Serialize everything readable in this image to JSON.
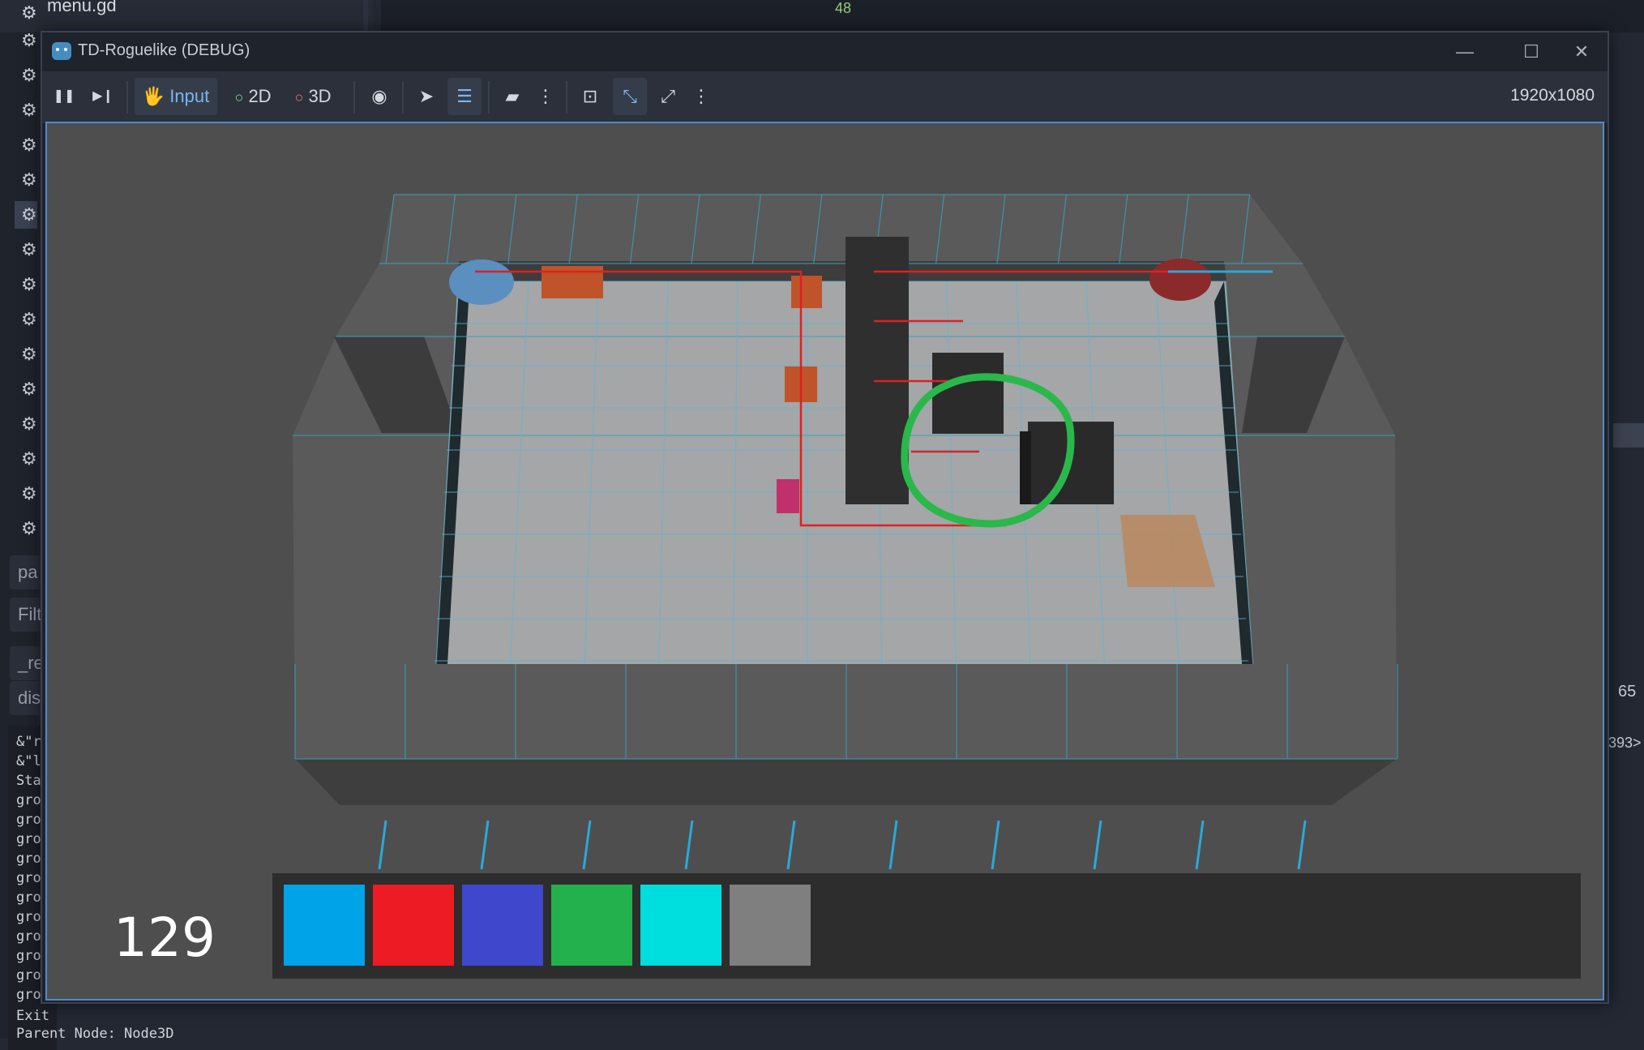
{
  "editor": {
    "file_name": "menu.gd",
    "line_number": "48",
    "side_fields": [
      "pa",
      "Filt",
      "_re",
      "dis"
    ],
    "console_lines": [
      "&\"r",
      "&\"l",
      "Sta",
      "gro",
      "gro",
      "gro",
      "gro",
      "gro",
      "gro",
      "gro",
      "gro",
      "gro",
      "gro",
      "gro"
    ],
    "console_exit": "Exit",
    "console_parent": "Parent Node: Node3D",
    "right_number": "65",
    "right_tag": "393>"
  },
  "window": {
    "title": "TD-Roguelike (DEBUG)",
    "minimize": "—",
    "maximize": "☐",
    "close": "✕"
  },
  "toolbar": {
    "pause": "❚❚",
    "step": "▶❙",
    "input_label": "Input",
    "label_2d": "2D",
    "label_3d": "3D",
    "resolution": "1920x1080",
    "icons": [
      "pause-icon",
      "next-frame-icon",
      "input-icon",
      "2d-icon",
      "3d-icon",
      "eye-icon",
      "select-icon",
      "list-select-icon",
      "camera-icon",
      "more-icon",
      "focus-icon",
      "fit-icon",
      "fullscreen-icon",
      "more-icon"
    ]
  },
  "game": {
    "counter": "129",
    "hotbar_colors": [
      "#00a2e8",
      "#ed1c24",
      "#3f48cc",
      "#22b14c",
      "#00dddd",
      "#7f7f7f"
    ]
  }
}
